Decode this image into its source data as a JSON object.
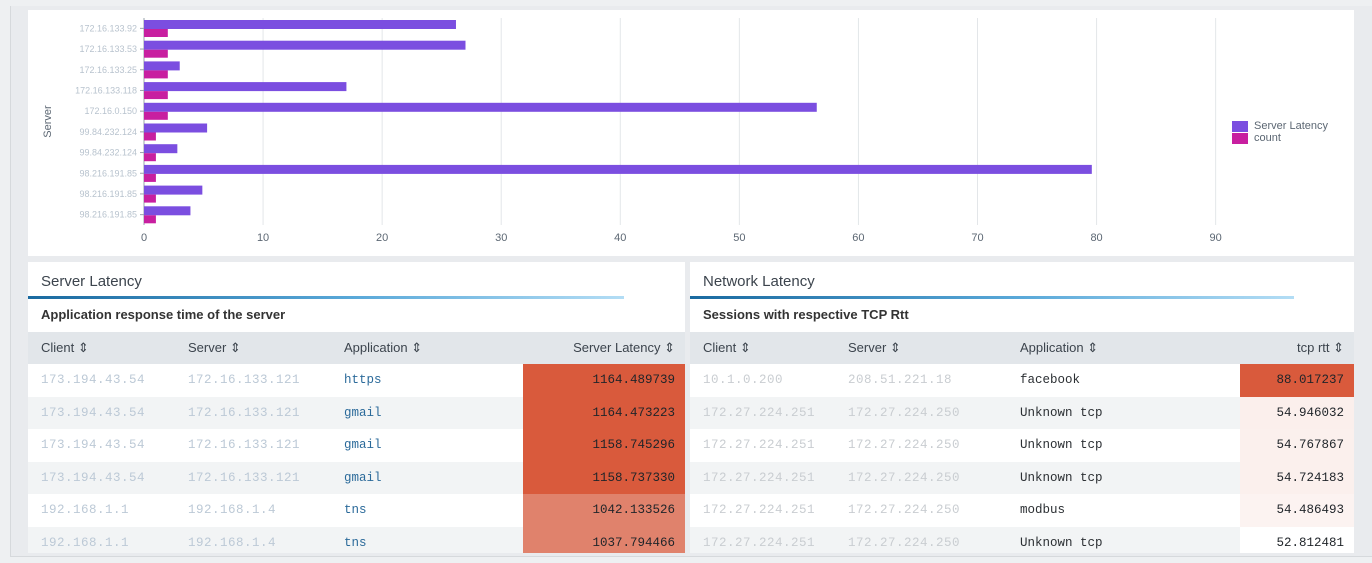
{
  "chart_data": {
    "type": "bar",
    "orientation": "horizontal",
    "ylabel": "Server",
    "xlabel": "",
    "xlim": [
      0,
      97
    ],
    "xticks": [
      0,
      10,
      20,
      30,
      40,
      50,
      60,
      70,
      80,
      90
    ],
    "grid": true,
    "legend_position": "right",
    "categories": [
      "172.16.133.92",
      "172.16.133.53",
      "172.16.133.25",
      "172.16.133.118",
      "172.16.0.150",
      "99.84.232.124",
      "99.84.232.124",
      "98.216.191.85",
      "98.216.191.85",
      "98.216.191.85"
    ],
    "series": [
      {
        "name": "Server Latency",
        "color": "#7b4ee0",
        "values": [
          26.2,
          27.0,
          3.0,
          17.0,
          56.5,
          5.3,
          2.8,
          79.6,
          4.9,
          3.9
        ]
      },
      {
        "name": "count",
        "color": "#c81fa0",
        "values": [
          2,
          2,
          2,
          2,
          2,
          1,
          1,
          1,
          1,
          1
        ]
      }
    ]
  },
  "server_latency": {
    "title": "Server Latency",
    "subtitle": "Application response time of the server",
    "columns": [
      "Client ⇕",
      "Server ⇕",
      "Application ⇕",
      "Server Latency ⇕"
    ],
    "rows": [
      {
        "client": "173.194.43.54",
        "server": "172.16.133.121",
        "application": "https",
        "value": "1164.489739",
        "color": "#d95a3c"
      },
      {
        "client": "173.194.43.54",
        "server": "172.16.133.121",
        "application": "gmail",
        "value": "1164.473223",
        "color": "#d95a3c"
      },
      {
        "client": "173.194.43.54",
        "server": "172.16.133.121",
        "application": "gmail",
        "value": "1158.745296",
        "color": "#d95a3c"
      },
      {
        "client": "173.194.43.54",
        "server": "172.16.133.121",
        "application": "gmail",
        "value": "1158.737330",
        "color": "#d95a3c"
      },
      {
        "client": "192.168.1.1",
        "server": "192.168.1.4",
        "application": "tns",
        "value": "1042.133526",
        "color": "#e0826c"
      },
      {
        "client": "192.168.1.1",
        "server": "192.168.1.4",
        "application": "tns",
        "value": "1037.794466",
        "color": "#e0826c"
      }
    ]
  },
  "network_latency": {
    "title": "Network Latency",
    "subtitle": "Sessions with respective TCP Rtt",
    "columns": [
      "Client ⇕",
      "Server ⇕",
      "Application ⇕",
      "tcp rtt ⇕"
    ],
    "rows": [
      {
        "client": "10.1.0.200",
        "server": "208.51.221.18",
        "application": "facebook",
        "value": "88.017237",
        "color": "#d95a3c"
      },
      {
        "client": "172.27.224.251",
        "server": "172.27.224.250",
        "application": "Unknown tcp",
        "value": "54.946032",
        "color": "#fbefec"
      },
      {
        "client": "172.27.224.251",
        "server": "172.27.224.250",
        "application": "Unknown tcp",
        "value": "54.767867",
        "color": "#fbf0ed"
      },
      {
        "client": "172.27.224.251",
        "server": "172.27.224.250",
        "application": "Unknown tcp",
        "value": "54.724183",
        "color": "#fbf0ed"
      },
      {
        "client": "172.27.224.251",
        "server": "172.27.224.250",
        "application": "modbus",
        "value": "54.486493",
        "color": "#fcf3f1"
      },
      {
        "client": "172.27.224.251",
        "server": "172.27.224.250",
        "application": "Unknown tcp",
        "value": "52.812481",
        "color": "#ffffff"
      }
    ]
  }
}
